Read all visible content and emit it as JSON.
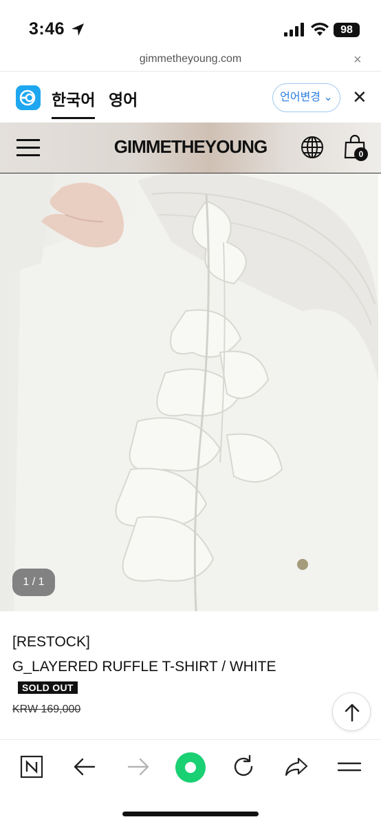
{
  "status_bar": {
    "time": "3:46",
    "battery": "98"
  },
  "url_bar": {
    "domain": "gimmetheyoung.com",
    "close_glyph": "×"
  },
  "translate_bar": {
    "lang_korean": "한국어",
    "lang_english": "영어",
    "change_button": "언어변경 ⌄",
    "close_glyph": "✕"
  },
  "site_header": {
    "logo": "GIMMETHEYOUNG",
    "cart_count": "0"
  },
  "product": {
    "image_counter": "1 / 1",
    "tag": "[RESTOCK]",
    "name": "G_LAYERED RUFFLE T-SHIRT / WHITE",
    "status_badge": "SOLD OUT",
    "price": "KRW 169,000"
  },
  "icons": {
    "location": "location-arrow-icon",
    "signal": "cellular-signal-icon",
    "wifi": "wifi-icon",
    "translate_app": "papago-icon",
    "menu": "hamburger-menu-icon",
    "language": "globe-icon",
    "cart": "shopping-bag-icon",
    "scroll_top": "arrow-up-icon",
    "toolbar": [
      "naver-home-icon",
      "back-arrow-icon",
      "forward-arrow-icon",
      "green-dot-icon",
      "refresh-icon",
      "share-icon",
      "menu-lines-icon"
    ]
  },
  "colors": {
    "accent_green": "#19d073",
    "link_blue": "#2b7de0",
    "papago_blue": "#1ea7f0"
  }
}
